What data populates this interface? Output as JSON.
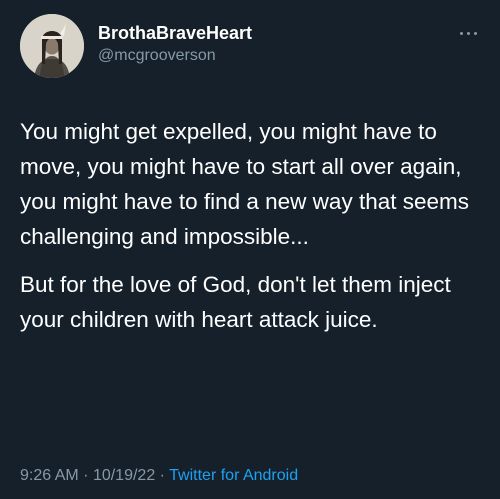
{
  "user": {
    "display_name": "BrothaBraveHeart",
    "handle": "@mcgrooverson",
    "avatar_icon": "profile-photo"
  },
  "more_icon": "more-dots-icon",
  "tweet": {
    "paragraphs": [
      "You might get expelled, you might have to move, you might have to start all over again, you might have to find a new way that seems challenging and impossible...",
      "But for the love of God, don't let them inject your children with heart attack juice."
    ]
  },
  "meta": {
    "time": "9:26 AM",
    "separator": "·",
    "date": "10/19/22",
    "source": "Twitter for Android"
  },
  "colors": {
    "background": "#15202b",
    "text": "#ffffff",
    "secondary": "#8899a6",
    "link": "#1da1f2"
  }
}
